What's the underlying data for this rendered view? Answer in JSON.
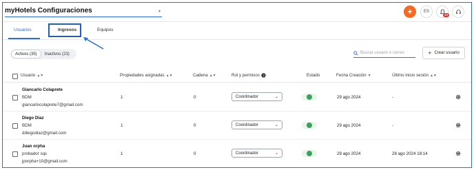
{
  "header": {
    "app_title": "myHotels Configuraciones",
    "lang_label": "ES",
    "notif_count": "10"
  },
  "tabs": [
    {
      "label": "Usuarios"
    },
    {
      "label": "Ingresos"
    },
    {
      "label": "Equipos"
    }
  ],
  "filters": {
    "active_label": "Activos (35)",
    "inactive_label": "Inactivos (23)"
  },
  "search": {
    "placeholder": "Buscar usuario o correo"
  },
  "create_button": "Crear usuario",
  "table": {
    "columns": [
      "Usuario",
      "Propiedades asignadas",
      "Cadena",
      "Rol y permisos",
      "Estado",
      "Fecha Creación",
      "Último inicio sesión"
    ],
    "rows": [
      {
        "name": "Giancarlo Colaprete",
        "role": "BDM",
        "email": "giancarlocolaprete7@gmail.com",
        "properties": "1",
        "chain": "0",
        "rol": "Coordinador",
        "created": "29 ago 2024",
        "last_login": "-"
      },
      {
        "name": "Diego Diaz",
        "role": "BDM",
        "email": "ddiegodiaz@gmail.com",
        "properties": "1",
        "chain": "0",
        "rol": "Coordinador",
        "created": "29 ago 2024",
        "last_login": "-"
      },
      {
        "name": "Juan orpha",
        "role": "probador sqs",
        "email": "jporpha+10@gmail.com",
        "properties": "1",
        "chain": "0",
        "rol": "Coordinador",
        "created": "28 ago 2024",
        "last_login": "28 ago 2024 18:14"
      }
    ]
  },
  "colors": {
    "accent": "#2a6fd6",
    "plus_button": "#f36a22",
    "status_active": "#3aa35b",
    "badge": "#e23a3a"
  }
}
